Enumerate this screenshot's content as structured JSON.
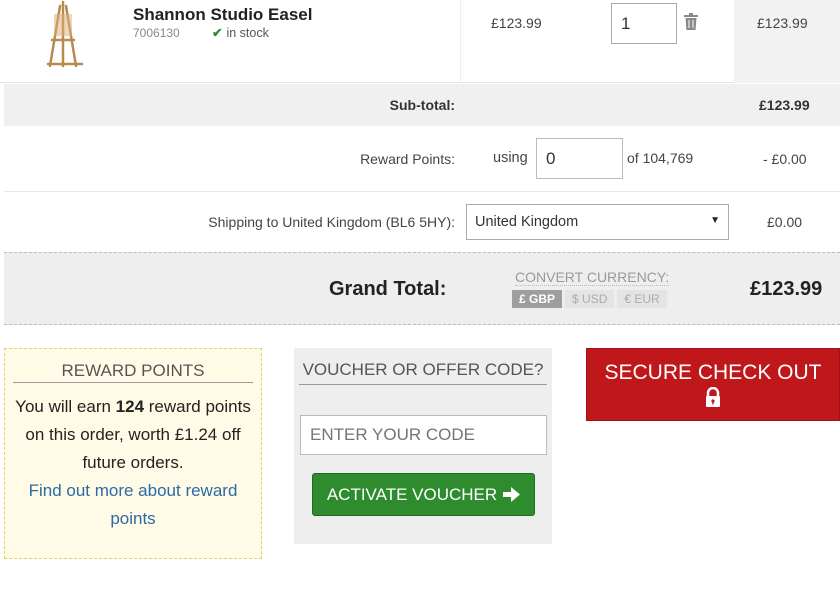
{
  "product": {
    "name": "Shannon Studio Easel",
    "code": "7006130",
    "stock": "in stock",
    "unit_price": "£123.99",
    "quantity": "1",
    "line_total": "£123.99"
  },
  "subtotal": {
    "label": "Sub-total:",
    "value": "£123.99"
  },
  "reward_points": {
    "label": "Reward Points:",
    "using": "using",
    "input_value": "0",
    "of_total": "of 104,769",
    "value": "- £0.00"
  },
  "shipping": {
    "label": "Shipping to United Kingdom (BL6 5HY):",
    "selected": "United Kingdom",
    "value": "£0.00"
  },
  "grand_total": {
    "label": "Grand Total:",
    "convert_label": "CONVERT CURRENCY:",
    "currencies": [
      "£ GBP",
      "$ USD",
      "€ EUR"
    ],
    "active_currency": "£ GBP",
    "value": "£123.99"
  },
  "reward_box": {
    "title": "REWARD POINTS",
    "text_before": "You will earn ",
    "points": "124",
    "text_after": " reward points on this order, worth £1.24 off future orders.",
    "link": "Find out more about reward points"
  },
  "voucher": {
    "title": "VOUCHER OR OFFER CODE?",
    "placeholder": "ENTER YOUR CODE",
    "button": "ACTIVATE VOUCHER"
  },
  "checkout": {
    "label": "SECURE CHECK OUT"
  },
  "colors": {
    "checkout_red": "#c0171b",
    "voucher_green": "#2e8b2e",
    "link_blue": "#2b6aa8",
    "reward_bg": "#fffbe6"
  },
  "icons": [
    "easel-product-image",
    "check-icon",
    "trash-icon",
    "dropdown-arrow-icon",
    "arrow-right-icon",
    "lock-icon"
  ]
}
